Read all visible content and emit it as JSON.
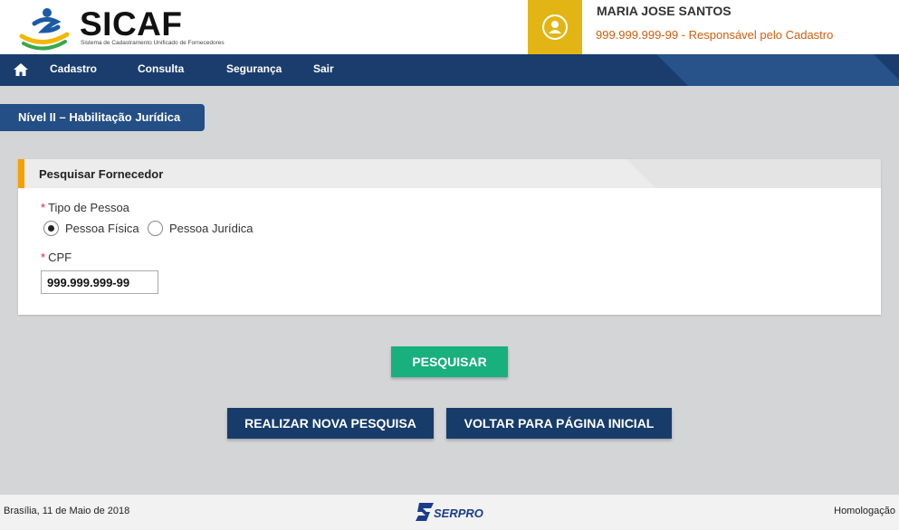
{
  "header": {
    "logo_title": "SICAF",
    "logo_subtitle": "Sistema de Cadastramento Unificado de Fornecedores",
    "user_name": "MARIA JOSE SANTOS",
    "user_id": "999.999.999-99",
    "user_role": " - Responsável pelo Cadastro"
  },
  "nav": {
    "items": [
      {
        "label": "Cadastro"
      },
      {
        "label": "Consulta"
      },
      {
        "label": "Segurança"
      },
      {
        "label": "Sair"
      }
    ]
  },
  "level_tab": "Nível II – Habilitação Jurídica",
  "panel": {
    "title": "Pesquisar Fornecedor",
    "tipo_label": "Tipo de Pessoa",
    "required_mark": "*",
    "options": [
      {
        "label": "Pessoa Física",
        "selected": true
      },
      {
        "label": "Pessoa Jurídica",
        "selected": false
      }
    ],
    "cpf_label": "CPF",
    "cpf_value": "999.999.999-99"
  },
  "buttons": {
    "search": "PESQUISAR",
    "new_search": "REALIZAR NOVA PESQUISA",
    "back_home": "VOLTAR PARA PÁGINA INICIAL"
  },
  "footer": {
    "date": "Brasília, 11 de Maio de 2018",
    "brand": "SERPRO",
    "environment": "Homologação"
  },
  "colors": {
    "navbar": "#1a3d6d",
    "accent_yellow": "#e2b514",
    "role_orange": "#d25d0c",
    "search_green": "#18b07d",
    "button_blue": "#173c6a"
  }
}
